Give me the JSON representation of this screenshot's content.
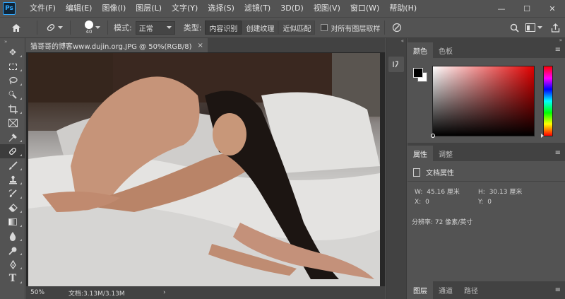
{
  "menubar": {
    "logo": "Ps",
    "items": [
      "文件(F)",
      "编辑(E)",
      "图像(I)",
      "图层(L)",
      "文字(Y)",
      "选择(S)",
      "滤镜(T)",
      "3D(D)",
      "视图(V)",
      "窗口(W)",
      "帮助(H)"
    ],
    "window_controls": [
      "—",
      "☐",
      "✕"
    ]
  },
  "options": {
    "brush_size": "40",
    "mode_label": "模式:",
    "mode_value": "正常",
    "type_label": "类型:",
    "type_buttons": [
      "内容识别",
      "创建纹理",
      "近似匹配"
    ],
    "sample_all_label": "对所有图层取样"
  },
  "document": {
    "tab_title": "猫哥哥的博客www.dujin.org.JPG @ 50%(RGB/8)",
    "tab_close": "×",
    "zoom": "50%",
    "doc_info": "文档:3.13M/3.13M",
    "status_arrow": "›"
  },
  "panels": {
    "color_tabs": [
      "颜色",
      "色板"
    ],
    "properties_tabs": [
      "属性",
      "调整"
    ],
    "doc_properties_label": "文档属性",
    "width_label": "W:",
    "width_value": "45.16 厘米",
    "height_label": "H:",
    "height_value": "30.13 厘米",
    "x_label": "X:",
    "x_value": "0",
    "y_label": "Y:",
    "y_value": "0",
    "resolution": "分辨率: 72 像素/英寸",
    "layers_tabs": [
      "图层",
      "通道",
      "路径"
    ]
  },
  "colors": {
    "foreground": "#000000",
    "background": "#ffffff",
    "accent": "#31a8ff"
  }
}
